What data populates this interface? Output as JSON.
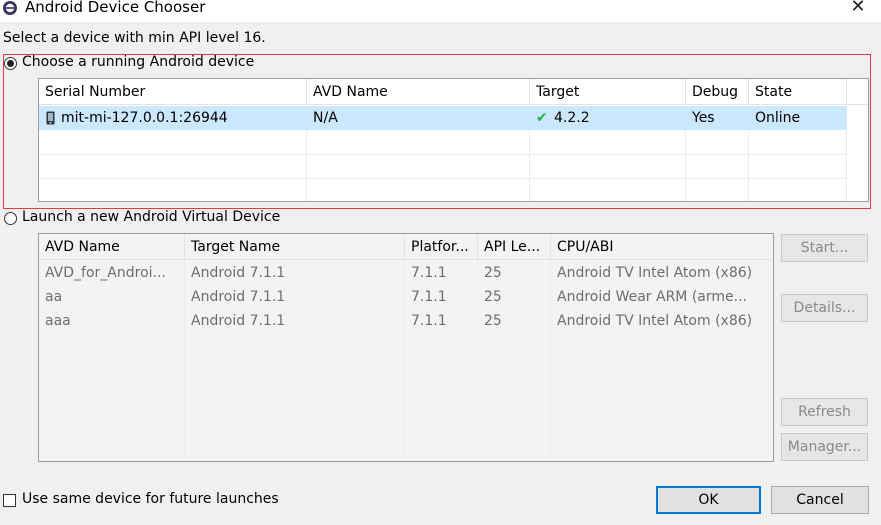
{
  "window": {
    "title": "Android Device Chooser",
    "close_icon": "close-icon"
  },
  "prompt": "Select a device with min API level 16.",
  "running": {
    "radio_label": "Choose a running Android device",
    "selected": true,
    "columns": [
      "Serial Number",
      "AVD Name",
      "Target",
      "Debug",
      "State"
    ],
    "rows": [
      {
        "serial": "mit-mi-127.0.0.1:26944",
        "avd": "N/A",
        "target": "4.2.2",
        "debug": "Yes",
        "state": "Online",
        "selected": true
      }
    ]
  },
  "avd": {
    "radio_label": "Launch a new Android Virtual Device",
    "selected": false,
    "columns": [
      "AVD Name",
      "Target Name",
      "Platfor...",
      "API Le...",
      "CPU/ABI"
    ],
    "rows": [
      [
        "AVD_for_Androi...",
        "Android 7.1.1",
        "7.1.1",
        "25",
        "Android TV Intel Atom (x86)"
      ],
      [
        "aa",
        "Android 7.1.1",
        "7.1.1",
        "25",
        "Android Wear ARM (arme..."
      ],
      [
        "aaa",
        "Android 7.1.1",
        "7.1.1",
        "25",
        "Android TV Intel Atom (x86)"
      ]
    ],
    "buttons": {
      "start": "Start...",
      "details": "Details...",
      "refresh": "Refresh",
      "manager": "Manager..."
    }
  },
  "footer": {
    "checkbox_label": "Use same device for future launches",
    "checkbox_checked": false,
    "ok": "OK",
    "cancel": "Cancel"
  },
  "colors": {
    "selection": "#cce8ff",
    "accent": "#0078d7",
    "highlight_border": "#e03c3c",
    "check": "#22b14c"
  }
}
